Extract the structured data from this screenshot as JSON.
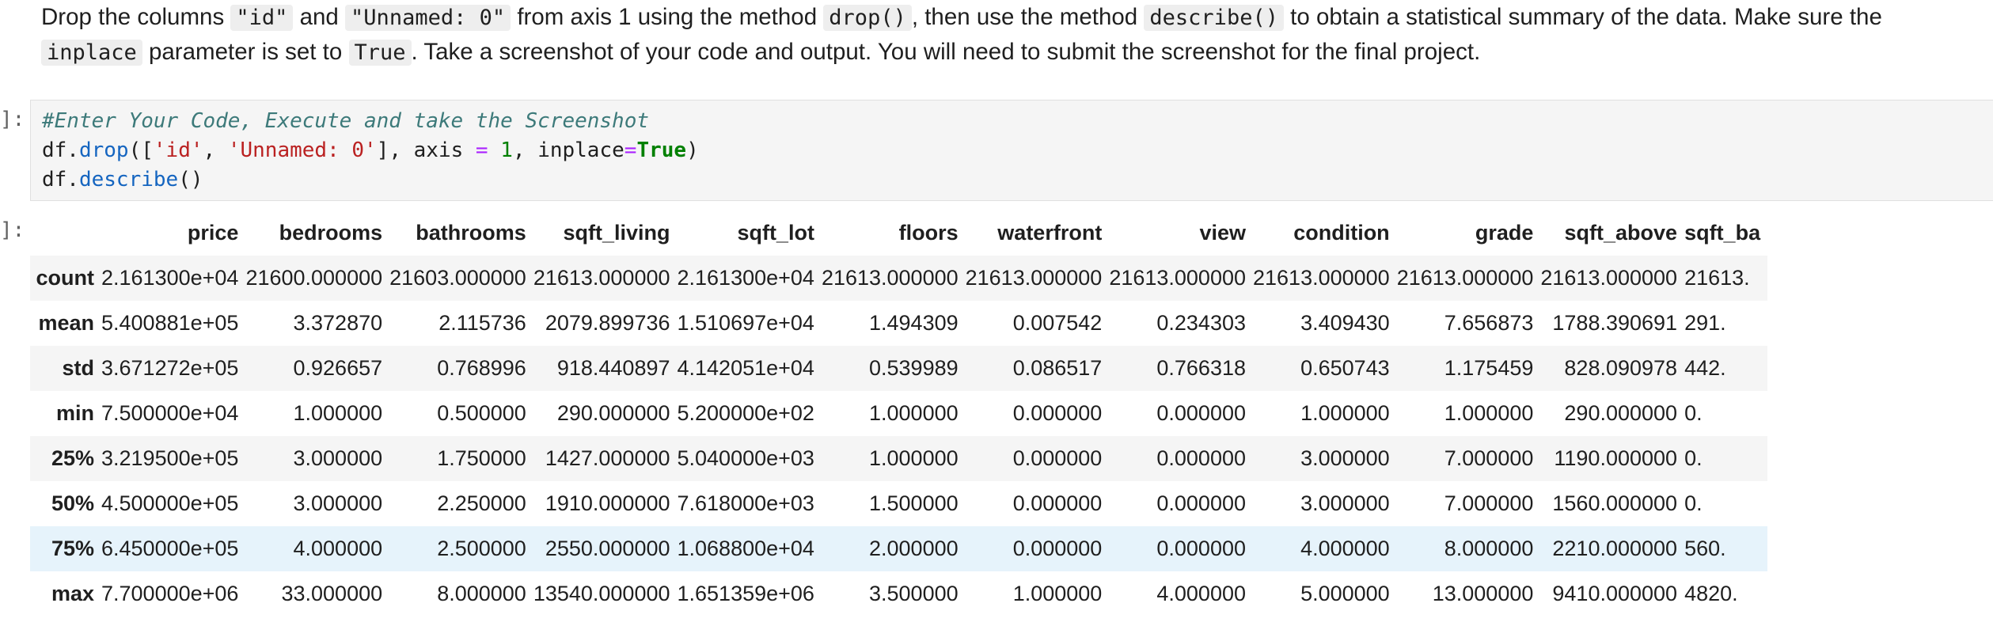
{
  "instruction": {
    "line1": [
      {
        "t": "text",
        "v": "Drop the columns "
      },
      {
        "t": "code",
        "v": "\"id\""
      },
      {
        "t": "text",
        "v": " and "
      },
      {
        "t": "code",
        "v": "\"Unnamed: 0\""
      },
      {
        "t": "text",
        "v": " from axis 1 using the method "
      },
      {
        "t": "code",
        "v": "drop()"
      },
      {
        "t": "text",
        "v": ", then use the method "
      },
      {
        "t": "code",
        "v": "describe()"
      },
      {
        "t": "text",
        "v": " to obtain a statistical summary of the data. Make sure the"
      }
    ],
    "line2": [
      {
        "t": "code",
        "v": "inplace"
      },
      {
        "t": "text",
        "v": " parameter is set to "
      },
      {
        "t": "code",
        "v": "True"
      },
      {
        "t": "text",
        "v": ". Take a screenshot of your code and output. You will need to submit the screenshot for the final project."
      }
    ]
  },
  "code_cell": {
    "prompt": "]:",
    "lines": [
      [
        {
          "c": "c-comment",
          "v": "#Enter Your Code, Execute and take the Screenshot"
        }
      ],
      [
        {
          "c": "c-pun",
          "v": "df."
        },
        {
          "c": "c-method",
          "v": "drop"
        },
        {
          "c": "c-pun",
          "v": "(["
        },
        {
          "c": "c-str",
          "v": "'id'"
        },
        {
          "c": "c-pun",
          "v": ", "
        },
        {
          "c": "c-str",
          "v": "'Unnamed: 0'"
        },
        {
          "c": "c-pun",
          "v": "], axis "
        },
        {
          "c": "c-op",
          "v": "="
        },
        {
          "c": "c-pun",
          "v": " "
        },
        {
          "c": "c-num",
          "v": "1"
        },
        {
          "c": "c-pun",
          "v": ", inplace"
        },
        {
          "c": "c-op",
          "v": "="
        },
        {
          "c": "c-kw",
          "v": "True"
        },
        {
          "c": "c-pun",
          "v": ")"
        }
      ],
      [
        {
          "c": "c-pun",
          "v": "df."
        },
        {
          "c": "c-method",
          "v": "describe"
        },
        {
          "c": "c-pun",
          "v": "()"
        }
      ]
    ]
  },
  "output": {
    "prompt": "]:",
    "columns": [
      "",
      "price",
      "bedrooms",
      "bathrooms",
      "sqft_living",
      "sqft_lot",
      "floors",
      "waterfront",
      "view",
      "condition",
      "grade",
      "sqft_above",
      "sqft_ba"
    ],
    "rows": [
      {
        "stat": "count",
        "values": [
          "2.161300e+04",
          "21600.000000",
          "21603.000000",
          "21613.000000",
          "2.161300e+04",
          "21613.000000",
          "21613.000000",
          "21613.000000",
          "21613.000000",
          "21613.000000",
          "21613.000000",
          "21613."
        ]
      },
      {
        "stat": "mean",
        "values": [
          "5.400881e+05",
          "3.372870",
          "2.115736",
          "2079.899736",
          "1.510697e+04",
          "1.494309",
          "0.007542",
          "0.234303",
          "3.409430",
          "7.656873",
          "1788.390691",
          "291."
        ]
      },
      {
        "stat": "std",
        "values": [
          "3.671272e+05",
          "0.926657",
          "0.768996",
          "918.440897",
          "4.142051e+04",
          "0.539989",
          "0.086517",
          "0.766318",
          "0.650743",
          "1.175459",
          "828.090978",
          "442."
        ]
      },
      {
        "stat": "min",
        "values": [
          "7.500000e+04",
          "1.000000",
          "0.500000",
          "290.000000",
          "5.200000e+02",
          "1.000000",
          "0.000000",
          "0.000000",
          "1.000000",
          "1.000000",
          "290.000000",
          "0."
        ]
      },
      {
        "stat": "25%",
        "values": [
          "3.219500e+05",
          "3.000000",
          "1.750000",
          "1427.000000",
          "5.040000e+03",
          "1.000000",
          "0.000000",
          "0.000000",
          "3.000000",
          "7.000000",
          "1190.000000",
          "0."
        ]
      },
      {
        "stat": "50%",
        "values": [
          "4.500000e+05",
          "3.000000",
          "2.250000",
          "1910.000000",
          "7.618000e+03",
          "1.500000",
          "0.000000",
          "0.000000",
          "3.000000",
          "7.000000",
          "1560.000000",
          "0."
        ]
      },
      {
        "stat": "75%",
        "values": [
          "6.450000e+05",
          "4.000000",
          "2.500000",
          "2550.000000",
          "1.068800e+04",
          "2.000000",
          "0.000000",
          "0.000000",
          "4.000000",
          "8.000000",
          "2210.000000",
          "560."
        ]
      },
      {
        "stat": "max",
        "values": [
          "7.700000e+06",
          "33.000000",
          "8.000000",
          "13540.000000",
          "1.651359e+06",
          "3.500000",
          "1.000000",
          "4.000000",
          "5.000000",
          "13.000000",
          "9410.000000",
          "4820."
        ]
      }
    ],
    "highlighted_row": "75%"
  }
}
